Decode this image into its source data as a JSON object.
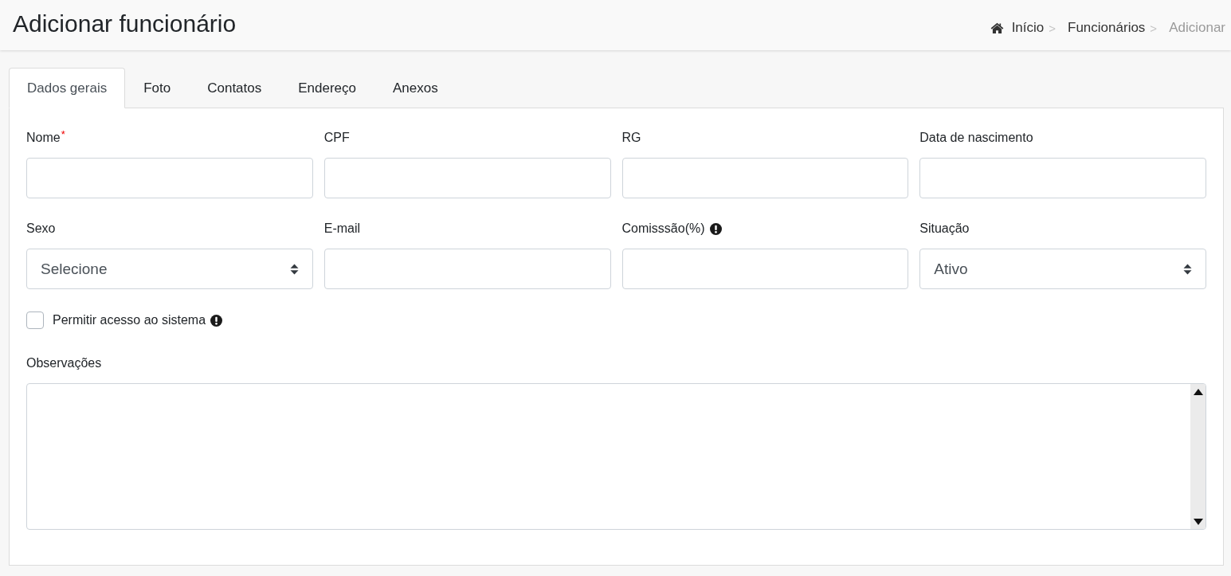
{
  "header": {
    "title": "Adicionar funcionário",
    "breadcrumb": [
      {
        "kind": "home",
        "label": "Início",
        "separator": ">",
        "current": false
      },
      {
        "kind": "link",
        "label": "Funcionários",
        "separator": ">",
        "current": false
      },
      {
        "kind": "link",
        "label": "Adicionar",
        "current": true
      }
    ]
  },
  "tabs": [
    {
      "label": "Dados gerais",
      "selected": true
    },
    {
      "label": "Foto",
      "selected": false
    },
    {
      "label": "Contatos",
      "selected": false
    },
    {
      "label": "Endereço",
      "selected": false
    },
    {
      "label": "Anexos",
      "selected": false
    }
  ],
  "form": {
    "fields": [
      {
        "kind": "text",
        "label": "Nome",
        "required_mark": "*",
        "info": false
      },
      {
        "kind": "text",
        "label": "CPF",
        "info": false
      },
      {
        "kind": "text",
        "label": "RG",
        "info": false
      },
      {
        "kind": "text",
        "label": "Data de nascimento",
        "info": false
      },
      {
        "kind": "select",
        "label": "Sexo",
        "value": "Selecione",
        "info": false
      },
      {
        "kind": "text",
        "label": "E-mail",
        "info": false
      },
      {
        "kind": "text",
        "label": "Comisssão(%)",
        "info": true
      },
      {
        "kind": "select",
        "label": "Situação",
        "value": "Ativo",
        "info": false
      }
    ],
    "checkbox": {
      "label": "Permitir acesso ao sistema",
      "checked": false,
      "info": true
    },
    "notes": {
      "label": "Observações"
    }
  }
}
